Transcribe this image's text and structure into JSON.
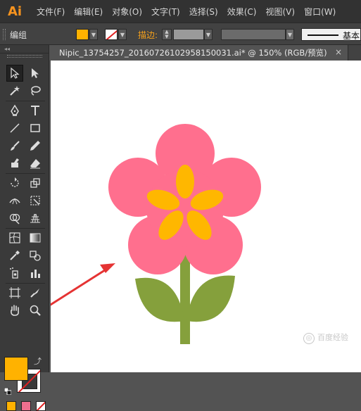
{
  "app": {
    "logo_text": "Ai"
  },
  "menu": [
    "文件(F)",
    "编辑(E)",
    "对象(O)",
    "文字(T)",
    "选择(S)",
    "效果(C)",
    "视图(V)",
    "窗口(W)"
  ],
  "control": {
    "selection_label": "编组",
    "fill_color": "#ffb200",
    "stroke_label": "描边:",
    "brush_label": "基本"
  },
  "toolbar": {
    "collapse_label": "◂◂",
    "tools": [
      "selection-tool",
      "direct-selection-tool",
      "magic-wand-tool",
      "lasso-tool",
      "pen-tool",
      "type-tool",
      "line-segment-tool",
      "rectangle-tool",
      "paintbrush-tool",
      "pencil-tool",
      "blob-brush-tool",
      "eraser-tool",
      "rotate-tool",
      "scale-tool",
      "width-tool",
      "free-transform-tool",
      "shape-builder-tool",
      "perspective-grid-tool",
      "mesh-tool",
      "gradient-tool",
      "eyedropper-tool",
      "blend-tool",
      "symbol-sprayer-tool",
      "column-graph-tool",
      "artboard-tool",
      "slice-tool",
      "hand-tool",
      "zoom-tool"
    ],
    "fill_color": "#ffb200",
    "swatch_colors": [
      "#ffb200",
      "#ef6f8f"
    ]
  },
  "document": {
    "tab_title": "Nipic_13754257_20160726102958150031.ai* @ 150% (RGB/预览)",
    "close_glyph": "×"
  },
  "artwork": {
    "petal_color": "#ff6f8e",
    "center_color": "#ffb700",
    "stem_color": "#85a03c",
    "arrow_color": "#e53333"
  },
  "watermark": {
    "text": "百度经验"
  }
}
